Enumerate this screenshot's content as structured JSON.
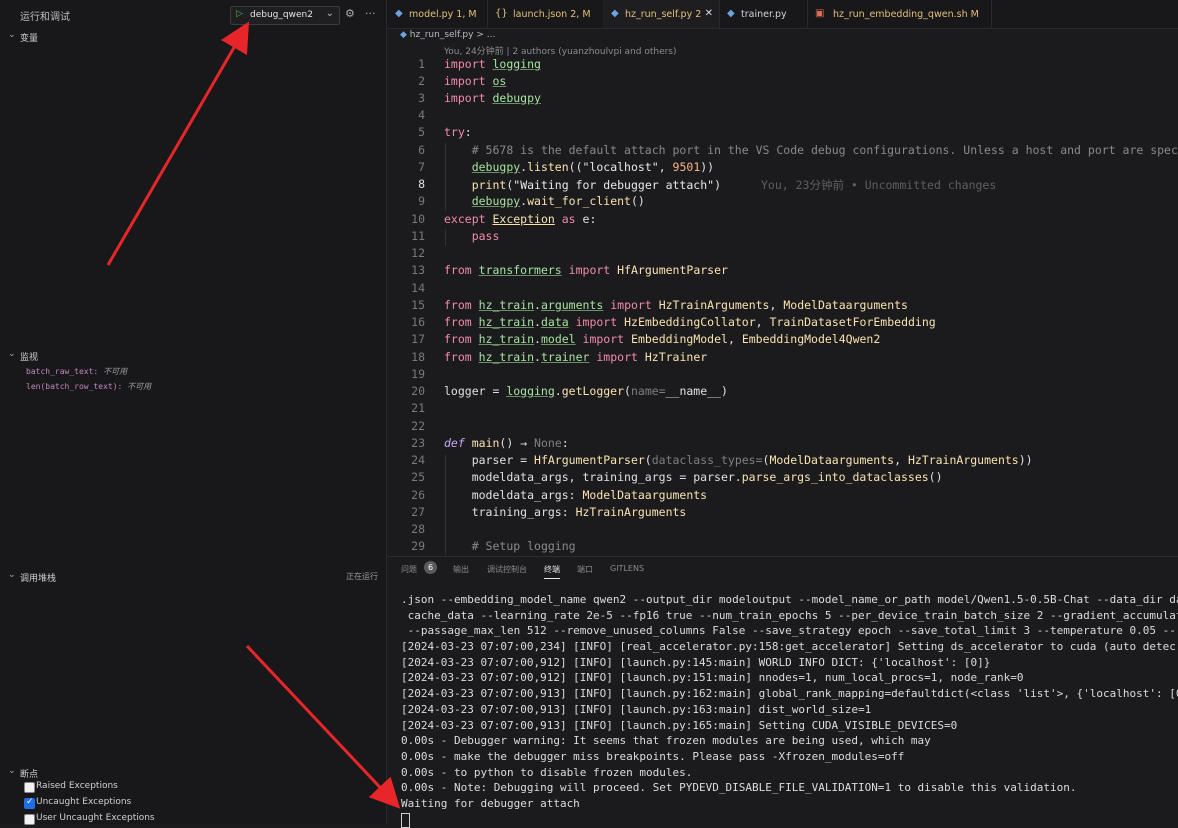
{
  "sidebar": {
    "run_title": "运行和调试",
    "config_name": "debug_qwen2",
    "sections": {
      "variables": "变量",
      "watch": "监视",
      "callstack": "调用堆栈",
      "callstack_status": "正在运行",
      "breakpoints": "断点"
    },
    "watch_items": [
      {
        "expr": "batch_raw_text:",
        "value": "不可用"
      },
      {
        "expr": "len(batch_row_text):",
        "value": "不可用"
      }
    ],
    "breakpoints": [
      {
        "label": "Raised Exceptions",
        "checked": false
      },
      {
        "label": "Uncaught Exceptions",
        "checked": true
      },
      {
        "label": "User Uncaught Exceptions",
        "checked": false
      }
    ]
  },
  "tabs": [
    {
      "name": "model.py",
      "status": "1, M",
      "color": "#e3c07a"
    },
    {
      "name": "launch.json",
      "status": "2, M",
      "color": "#e3c07a"
    },
    {
      "name": "hz_run_self.py",
      "status": "2",
      "color": "#e3c07a",
      "active": true
    },
    {
      "name": "trainer.py",
      "status": "",
      "color": "#d4d4d4"
    },
    {
      "name": "hz_run_embedding_qwen.sh",
      "status": "M",
      "color": "#e3c07a"
    }
  ],
  "editor": {
    "breadcrumb": "hz_run_self.py > ...",
    "blame_header": "You, 24分钟前 | 2 authors (yuanzhoulvpi and others)",
    "inline_blame": "You, 23分钟前 • Uncommitted changes",
    "comment_line": "# 5678 is the default attach port in the VS Code debug configurations. Unless a host and port are spec",
    "line_numbers": [
      "1",
      "2",
      "3",
      "4",
      "5",
      "6",
      "7",
      "8",
      "9",
      "10",
      "11",
      "12",
      "13",
      "14",
      "15",
      "16",
      "17",
      "18",
      "19",
      "20",
      "21",
      "22",
      "23",
      "24",
      "25",
      "26",
      "27",
      "28",
      "29"
    ],
    "setup_logging_comment": "# Setup logging"
  },
  "panel": {
    "tabs": [
      "问题",
      "输出",
      "调试控制台",
      "终端",
      "端口",
      "GITLENS"
    ],
    "problems_count": "6",
    "terminal_lines": [
      ".json --embedding_model_name qwen2 --output_dir modeloutput --model_name_or_path model/Qwen1.5-0.5B-Chat --data_dir da",
      " cache_data --learning_rate 2e-5 --fp16 true --num_train_epochs 5 --per_device_train_batch_size 2 --gradient_accumulat",
      " --passage_max_len 512 --remove_unused_columns False --save_strategy epoch --save_total_limit 3 --temperature 0.05 --",
      "[2024-03-23 07:07:00,234] [INFO] [real_accelerator.py:158:get_accelerator] Setting ds_accelerator to cuda (auto detec",
      "[2024-03-23 07:07:00,912] [INFO] [launch.py:145:main] WORLD INFO DICT: {'localhost': [0]}",
      "[2024-03-23 07:07:00,912] [INFO] [launch.py:151:main] nnodes=1, num_local_procs=1, node_rank=0",
      "[2024-03-23 07:07:00,913] [INFO] [launch.py:162:main] global_rank_mapping=defaultdict(<class 'list'>, {'localhost': [0",
      "[2024-03-23 07:07:00,913] [INFO] [launch.py:163:main] dist_world_size=1",
      "[2024-03-23 07:07:00,913] [INFO] [launch.py:165:main] Setting CUDA_VISIBLE_DEVICES=0",
      "0.00s - Debugger warning: It seems that frozen modules are being used, which may",
      "0.00s - make the debugger miss breakpoints. Please pass -Xfrozen_modules=off",
      "0.00s - to python to disable frozen modules.",
      "0.00s - Note: Debugging will proceed. Set PYDEVD_DISABLE_FILE_VALIDATION=1 to disable this validation.",
      "Waiting for debugger attach"
    ]
  },
  "colors": {
    "arrow": "#e8262a",
    "accent": "#1f6feb"
  }
}
